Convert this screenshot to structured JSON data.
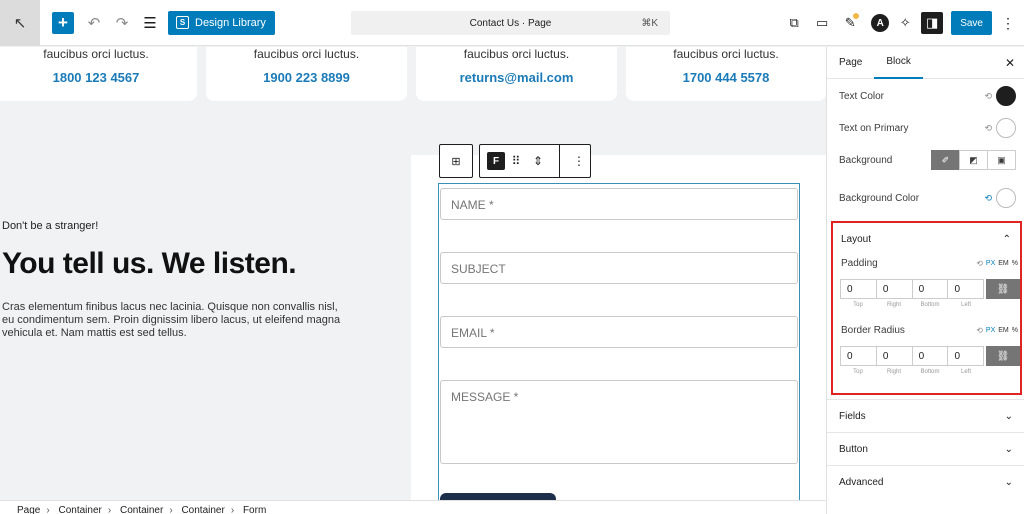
{
  "toolbar": {
    "design_library_label": "Design Library",
    "document_title": "Contact Us · Page",
    "shortcut": "⌘K",
    "save_label": "Save"
  },
  "cards": [
    {
      "text": "faucibus orci luctus.",
      "value": "1800 123 4567"
    },
    {
      "text": "faucibus orci luctus.",
      "value": "1900 223 8899"
    },
    {
      "text": "faucibus orci luctus.",
      "value": "returns@mail.com"
    },
    {
      "text": "faucibus orci luctus.",
      "value": "1700 444 5578"
    }
  ],
  "content": {
    "eyebrow": "Don't be a stranger!",
    "headline": "You tell us. We listen.",
    "description": "Cras elementum finibus lacus nec lacinia. Quisque non convallis nisl, eu condimentum sem. Proin dignissim libero lacus, ut eleifend magna vehicula et. Nam mattis est sed tellus."
  },
  "form": {
    "name_placeholder": "NAME *",
    "subject_placeholder": "SUBJECT",
    "email_placeholder": "EMAIL *",
    "message_placeholder": "MESSAGE *"
  },
  "breadcrumb": [
    "Page",
    "Container",
    "Container",
    "Container",
    "Form"
  ],
  "sidebar": {
    "tabs": [
      "Page",
      "Block"
    ],
    "active_tab": "Block",
    "rows": {
      "text_color": "Text Color",
      "text_on_primary": "Text on Primary",
      "background": "Background",
      "background_color": "Background Color"
    },
    "colors": {
      "text_color": "#1e1e1e",
      "text_on_primary": "#ffffff",
      "background_color": "#ffffff",
      "accent": "#007cba",
      "highlight": "#e02424"
    },
    "layout": {
      "title": "Layout",
      "padding_label": "Padding",
      "border_radius_label": "Border Radius",
      "units": [
        "PX",
        "EM",
        "%"
      ],
      "padding": {
        "top": "0",
        "right": "0",
        "bottom": "0",
        "left": "0"
      },
      "border_radius": {
        "top": "0",
        "right": "0",
        "bottom": "0",
        "left": "0"
      },
      "side_labels": [
        "Top",
        "Right",
        "Bottom",
        "Left"
      ]
    },
    "sections": [
      "Fields",
      "Button",
      "Advanced"
    ]
  }
}
